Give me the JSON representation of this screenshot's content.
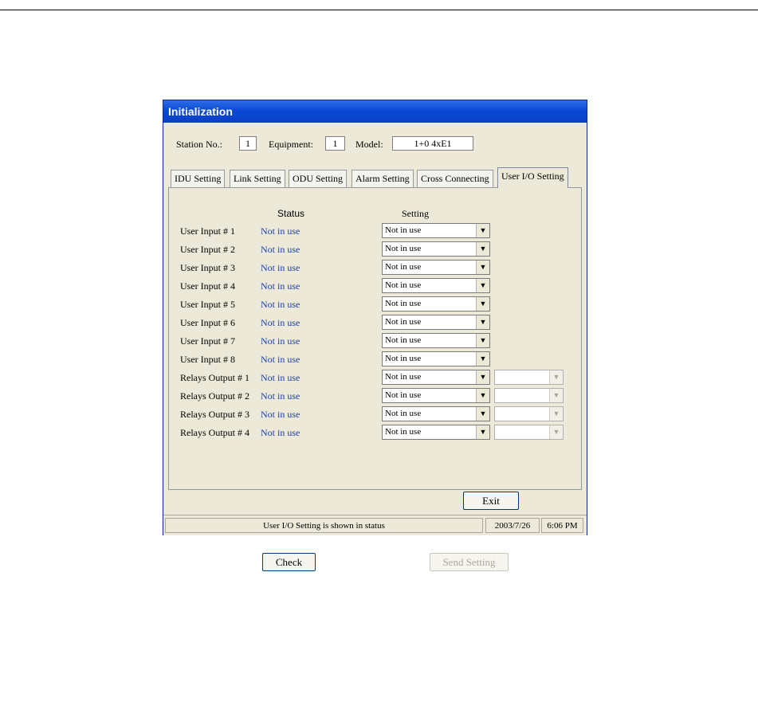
{
  "window": {
    "title": "Initialization"
  },
  "header": {
    "station_label": "Station No.:",
    "station_value": "1",
    "equipment_label": "Equipment:",
    "equipment_value": "1",
    "model_label": "Model:",
    "model_value": "1+0 4xE1"
  },
  "tabs": [
    {
      "label": "IDU Setting",
      "active": false
    },
    {
      "label": "Link Setting",
      "active": false
    },
    {
      "label": "ODU Setting",
      "active": false
    },
    {
      "label": "Alarm Setting",
      "active": false
    },
    {
      "label": "Cross Connecting",
      "active": false
    },
    {
      "label": "User I/O Setting",
      "active": true
    }
  ],
  "columns": {
    "status": "Status",
    "setting": "Setting"
  },
  "rows": [
    {
      "name": "User Input # 1",
      "status": "Not in use",
      "setting": "Not in use"
    },
    {
      "name": "User Input # 2",
      "status": "Not in use",
      "setting": "Not in use"
    },
    {
      "name": "User Input # 3",
      "status": "Not in use",
      "setting": "Not in use"
    },
    {
      "name": "User Input # 4",
      "status": "Not in use",
      "setting": "Not in use"
    },
    {
      "name": "User Input # 5",
      "status": "Not in use",
      "setting": "Not in use"
    },
    {
      "name": "User Input # 6",
      "status": "Not in use",
      "setting": "Not in use"
    },
    {
      "name": "User Input # 7",
      "status": "Not in use",
      "setting": "Not in use"
    },
    {
      "name": "User Input # 8",
      "status": "Not in use",
      "setting": "Not in use"
    },
    {
      "name": "Relays Output # 1",
      "status": "Not in use",
      "setting": "Not in use",
      "secondary": ""
    },
    {
      "name": "Relays Output # 2",
      "status": "Not in use",
      "setting": "Not in use",
      "secondary": ""
    },
    {
      "name": "Relays Output # 3",
      "status": "Not in use",
      "setting": "Not in use",
      "secondary": ""
    },
    {
      "name": "Relays Output # 4",
      "status": "Not in use",
      "setting": "Not in use",
      "secondary": ""
    }
  ],
  "buttons": {
    "check": "Check",
    "send": "Send Setting",
    "exit": "Exit"
  },
  "statusbar": {
    "message": "User I/O Setting is shown in status",
    "date": "2003/7/26",
    "time": "6:06 PM"
  },
  "colors": {
    "title_bar": "#0a4ad6",
    "status_text": "#1f3fa8",
    "dialog_bg": "#ece9d8"
  }
}
